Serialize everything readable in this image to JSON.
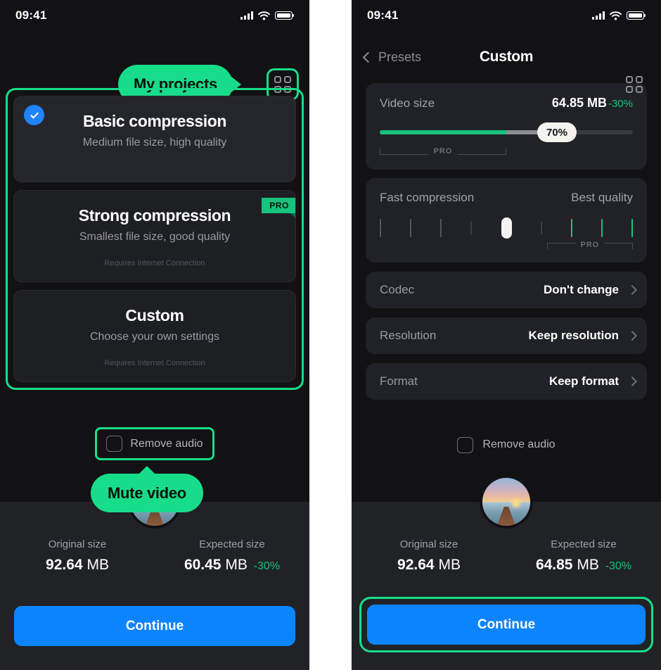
{
  "left": {
    "status": {
      "time": "09:41",
      "signal_icon": "cellular-signal-icon",
      "wifi_icon": "wifi-icon",
      "battery_icon": "battery-icon"
    },
    "callout_projects": "My projects",
    "grid_button_icon": "grid-view-icon",
    "presets": [
      {
        "title": "Basic compression",
        "subtitle": "Medium file size, high quality",
        "note": "",
        "selected": true,
        "pro": false
      },
      {
        "title": "Strong compression",
        "subtitle": "Smallest file size, good quality",
        "note": "Requires Internet Connection",
        "selected": false,
        "pro": true,
        "pro_label": "PRO"
      },
      {
        "title": "Custom",
        "subtitle": "Choose your own settings",
        "note": "Requires Internet Connection",
        "selected": false,
        "pro": false
      }
    ],
    "remove_audio_label": "Remove audio",
    "callout_mute": "Mute video",
    "original_size_label": "Original size",
    "original_size_value": "92.64",
    "original_size_unit": "MB",
    "expected_size_label": "Expected size",
    "expected_size_value": "60.45",
    "expected_size_unit": "MB",
    "expected_size_delta": "-30%",
    "continue_label": "Continue"
  },
  "right": {
    "status": {
      "time": "09:41"
    },
    "back_label": "Presets",
    "title": "Custom",
    "grid_button_icon": "grid-view-icon",
    "video_size": {
      "label": "Video size",
      "value": "64.85 MB",
      "delta": "-30%",
      "thumb_label": "70%",
      "pro_label": "PRO"
    },
    "quality": {
      "left_label": "Fast compression",
      "right_label": "Best quality",
      "pro_label": "PRO"
    },
    "options": [
      {
        "label": "Codec",
        "value": "Don't change"
      },
      {
        "label": "Resolution",
        "value": "Keep resolution"
      },
      {
        "label": "Format",
        "value": "Keep format"
      }
    ],
    "remove_audio_label": "Remove audio",
    "thumbnail_icon": "video-thumbnail",
    "original_size_label": "Original size",
    "original_size_value": "92.64",
    "original_size_unit": "MB",
    "expected_size_label": "Expected size",
    "expected_size_value": "64.85",
    "expected_size_unit": "MB",
    "expected_size_delta": "-30%",
    "continue_label": "Continue"
  },
  "colors": {
    "highlight_green": "#17dd8a",
    "accent_green": "#17c27c",
    "primary_blue": "#0b84fe",
    "select_blue": "#1f84ff",
    "panel_bg": "#121215"
  },
  "chart_data": {
    "type": "bar",
    "title": "Video size slider",
    "categories": [
      "green_fill",
      "gray_fill",
      "empty"
    ],
    "values": [
      50,
      16,
      34
    ],
    "ylabel": "percent of track",
    "ylim": [
      0,
      100
    ]
  }
}
